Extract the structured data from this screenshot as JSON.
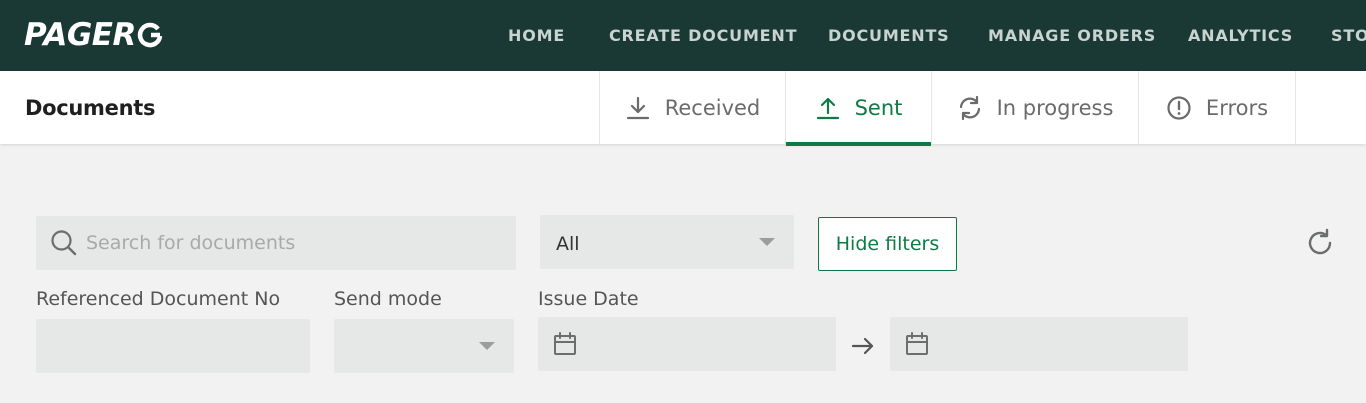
{
  "brand": {
    "logo_text": "PAGER"
  },
  "nav": {
    "items": [
      "HOME",
      "CREATE DOCUMENT",
      "DOCUMENTS",
      "MANAGE ORDERS",
      "ANALYTICS",
      "STO"
    ]
  },
  "header": {
    "title": "Documents",
    "tabs": [
      {
        "label": "Received",
        "icon": "download-icon"
      },
      {
        "label": "Sent",
        "icon": "upload-icon",
        "active": true
      },
      {
        "label": "In progress",
        "icon": "sync-icon"
      },
      {
        "label": "Errors",
        "icon": "error-icon"
      }
    ]
  },
  "filters": {
    "search_placeholder": "Search for documents",
    "status_select": "All",
    "hide_filters_label": "Hide filters",
    "referenced_doc_label": "Referenced Document No",
    "send_mode_label": "Send mode",
    "issue_date_label": "Issue Date"
  },
  "colors": {
    "nav_bg": "#1b3934",
    "accent": "#0f7a45",
    "page_bg": "#f1f2f1"
  }
}
